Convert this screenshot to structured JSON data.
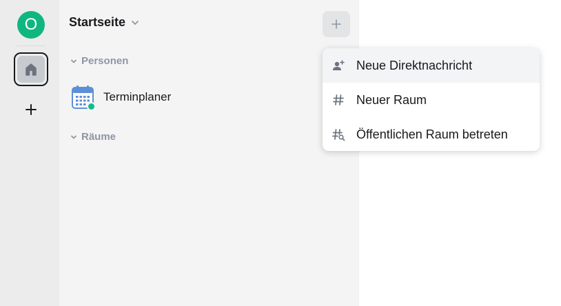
{
  "rail": {
    "avatar_letter": "O",
    "avatar_color": "#10b67f",
    "home_icon": "home-icon",
    "add_icon": "plus-icon"
  },
  "panel": {
    "title": "Startseite",
    "title_icon": "chevron-down-icon",
    "add_icon": "plus-icon",
    "sections": [
      {
        "label": "Personen",
        "icon": "chevron-down-icon"
      },
      {
        "label": "Räume",
        "icon": "chevron-down-icon"
      }
    ],
    "rooms": [
      {
        "name": "Terminplaner",
        "icon": "calendar-icon",
        "presence": "online",
        "presence_color": "#0dbd8b"
      }
    ]
  },
  "menu": {
    "items": [
      {
        "label": "Neue Direktnachricht",
        "icon": "add-person-icon"
      },
      {
        "label": "Neuer Raum",
        "icon": "hash-icon"
      },
      {
        "label": "Öffentlichen Raum betreten",
        "icon": "hash-search-icon"
      }
    ]
  }
}
